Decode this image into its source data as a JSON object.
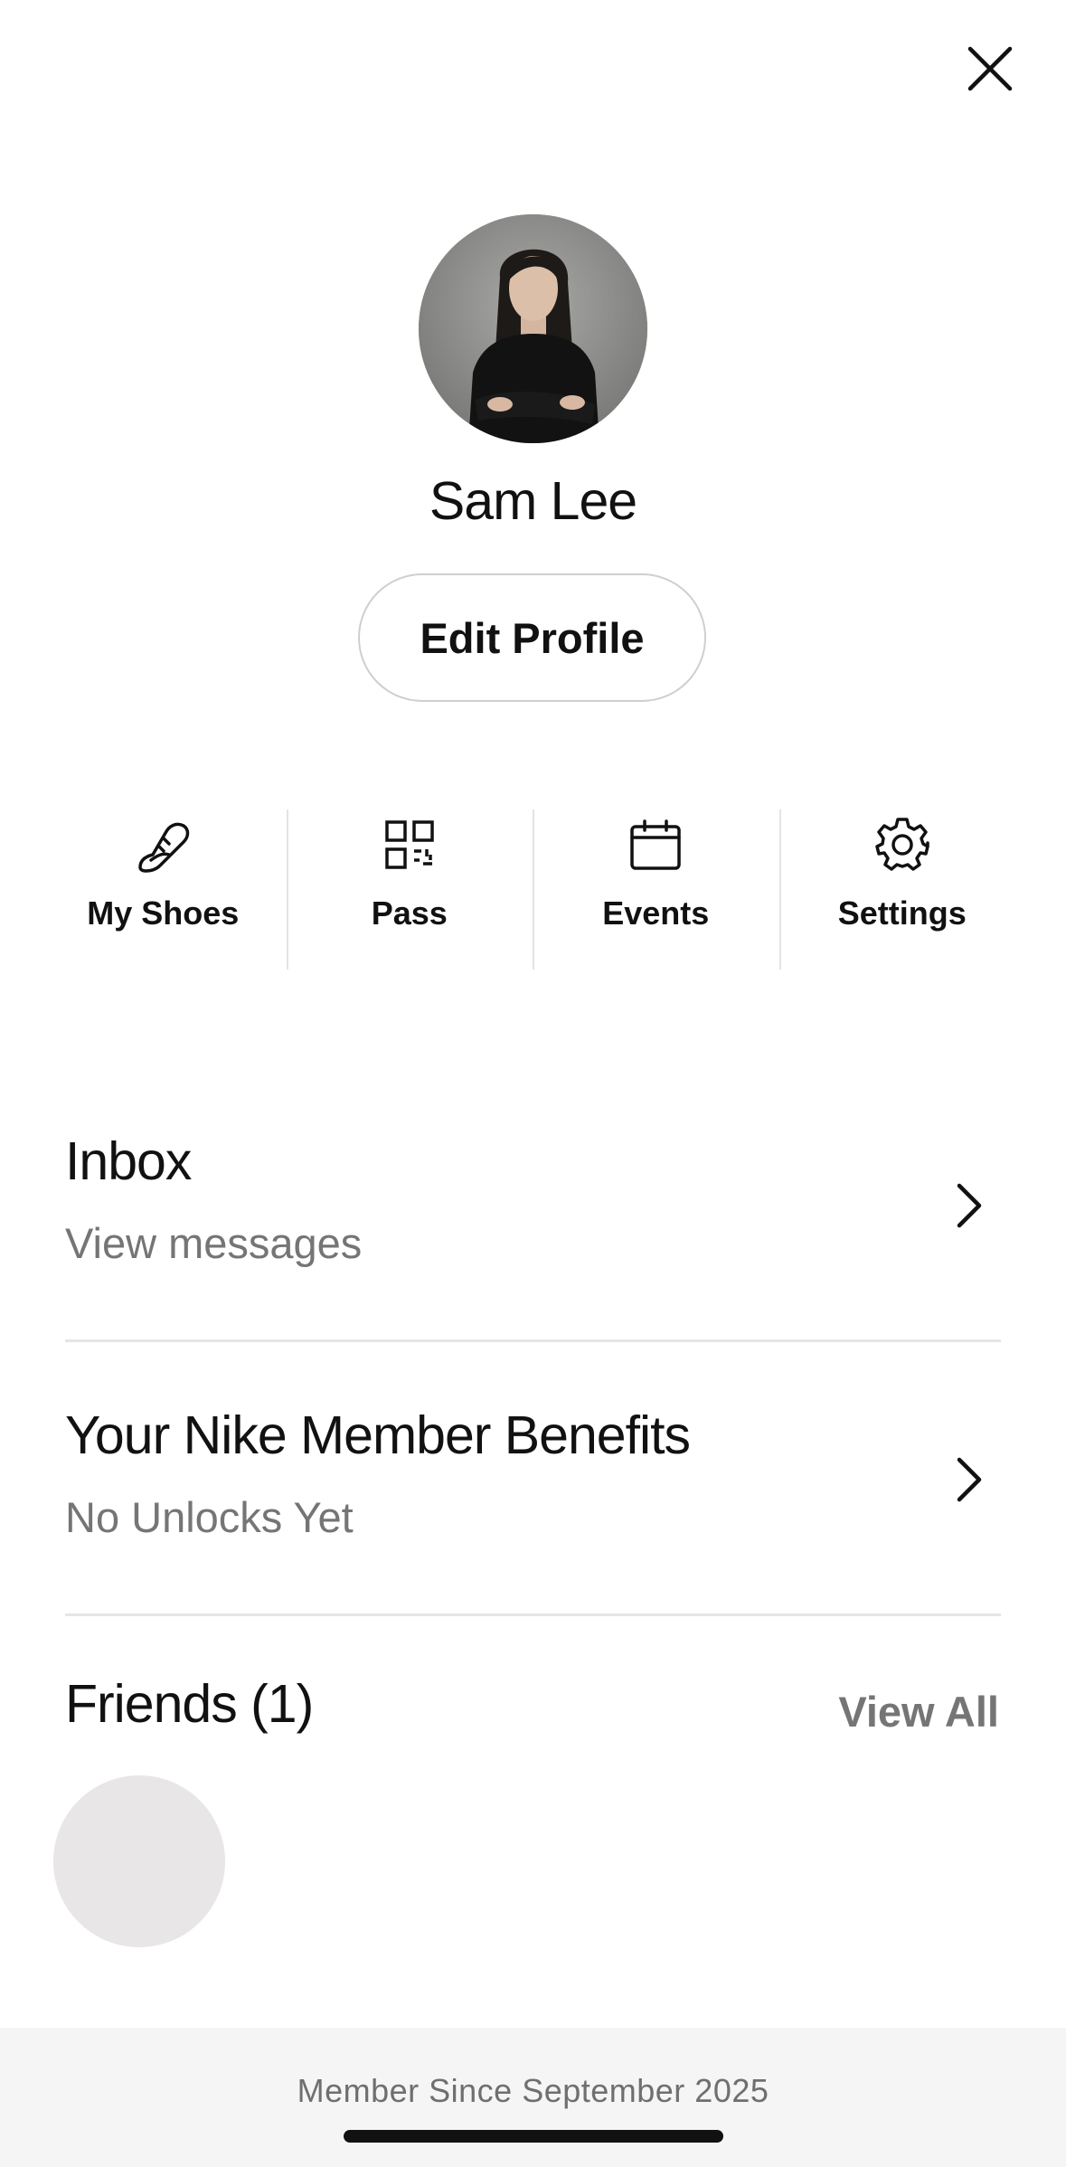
{
  "header": {
    "close_icon": "close-icon"
  },
  "profile": {
    "name": "Sam Lee",
    "edit_label": "Edit Profile",
    "avatar_icon": "profile-photo"
  },
  "quick_actions": [
    {
      "label": "My Shoes",
      "icon": "shoe-icon"
    },
    {
      "label": "Pass",
      "icon": "qr-code-icon"
    },
    {
      "label": "Events",
      "icon": "calendar-icon"
    },
    {
      "label": "Settings",
      "icon": "gear-icon"
    }
  ],
  "inbox": {
    "title": "Inbox",
    "subtitle": "View messages"
  },
  "benefits": {
    "title": "Your Nike Member Benefits",
    "subtitle": "No Unlocks Yet"
  },
  "friends": {
    "title": "Friends (1)",
    "view_all": "View All"
  },
  "footer": {
    "member_since": "Member Since September 2025"
  },
  "colors": {
    "text_primary": "#111111",
    "text_secondary": "#757575",
    "divider": "#e5e5e5",
    "footer_bg": "#f5f5f5"
  }
}
